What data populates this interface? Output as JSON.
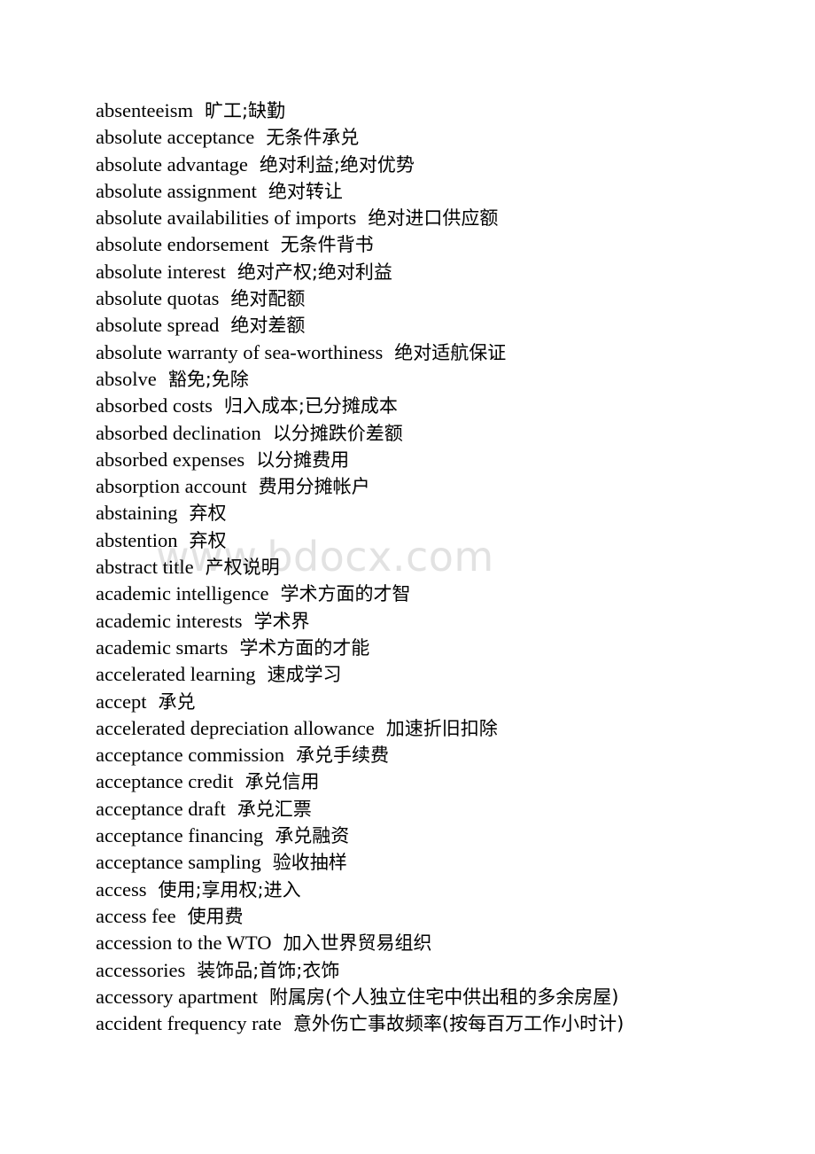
{
  "page": {
    "background_color": "#ffffff",
    "text_color": "#000000",
    "kind": "bilingual-glossary-page"
  },
  "watermark": {
    "text": "www.bdocx.com",
    "color": "#e2e2e2"
  },
  "glossary": {
    "entries": [
      {
        "term": "absenteeism",
        "gloss": "旷工;缺勤"
      },
      {
        "term": "absolute acceptance",
        "gloss": "无条件承兑"
      },
      {
        "term": "absolute advantage",
        "gloss": "绝对利益;绝对优势"
      },
      {
        "term": "absolute assignment",
        "gloss": "绝对转让"
      },
      {
        "term": "absolute availabilities of imports",
        "gloss": "绝对进口供应额"
      },
      {
        "term": "absolute endorsement",
        "gloss": "无条件背书"
      },
      {
        "term": "absolute interest",
        "gloss": "绝对产权;绝对利益"
      },
      {
        "term": "absolute quotas",
        "gloss": "绝对配额"
      },
      {
        "term": "absolute spread",
        "gloss": "绝对差额"
      },
      {
        "term": "absolute warranty of sea-worthiness",
        "gloss": "绝对适航保证"
      },
      {
        "term": "absolve",
        "gloss": "豁免;免除"
      },
      {
        "term": "absorbed costs",
        "gloss": "归入成本;已分摊成本"
      },
      {
        "term": "absorbed declination",
        "gloss": "以分摊跌价差额"
      },
      {
        "term": "absorbed expenses",
        "gloss": "以分摊费用"
      },
      {
        "term": "absorption account",
        "gloss": "费用分摊帐户"
      },
      {
        "term": "abstaining",
        "gloss": "弃权"
      },
      {
        "term": "abstention",
        "gloss": "弃权"
      },
      {
        "term": "abstract title",
        "gloss": "产权说明"
      },
      {
        "term": "academic intelligence",
        "gloss": "学术方面的才智"
      },
      {
        "term": "academic interests",
        "gloss": "学术界"
      },
      {
        "term": "academic smarts",
        "gloss": "学术方面的才能"
      },
      {
        "term": "accelerated learning",
        "gloss": "速成学习"
      },
      {
        "term": "accept",
        "gloss": "承兑"
      },
      {
        "term": "accelerated depreciation allowance",
        "gloss": "加速折旧扣除"
      },
      {
        "term": "acceptance commission",
        "gloss": "承兑手续费"
      },
      {
        "term": "acceptance credit",
        "gloss": "承兑信用"
      },
      {
        "term": "acceptance draft",
        "gloss": "承兑汇票"
      },
      {
        "term": "acceptance financing",
        "gloss": "承兑融资"
      },
      {
        "term": "acceptance sampling",
        "gloss": "验收抽样"
      },
      {
        "term": "access",
        "gloss": "使用;享用权;进入"
      },
      {
        "term": "access fee",
        "gloss": "使用费"
      },
      {
        "term": "accession to the WTO",
        "gloss": "加入世界贸易组织"
      },
      {
        "term": "accessories",
        "gloss": "装饰品;首饰;衣饰"
      },
      {
        "term": "accessory apartment",
        "gloss": "附属房(个人独立住宅中供出租的多余房屋)"
      },
      {
        "term": "accident frequency rate",
        "gloss": "意外伤亡事故频率(按每百万工作小时计)"
      }
    ]
  }
}
